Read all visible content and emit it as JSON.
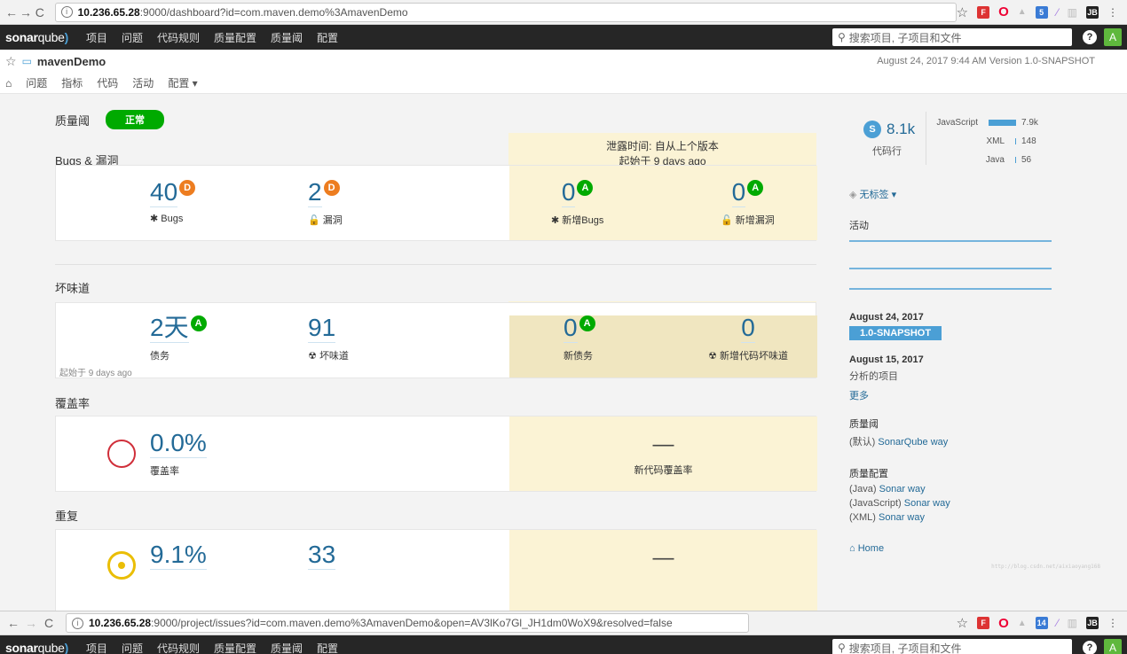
{
  "browser1": {
    "url_host": "10.236.65.28",
    "url_rest": ":9000/dashboard?id=com.maven.demo%3AmavenDemo",
    "ext_badge": "5"
  },
  "browser2": {
    "url_host": "10.236.65.28",
    "url_rest": ":9000/project/issues?id=com.maven.demo%3AmavenDemo&open=AV3lKo7Gl_JH1dm0WoX9&resolved=false",
    "ext_badge": "14"
  },
  "nav": {
    "logo_a": "sonar",
    "logo_b": "qube",
    "menu": [
      "项目",
      "问题",
      "代码规则",
      "质量配置",
      "质量阈",
      "配置"
    ],
    "search_placeholder": "搜索项目, 子项目和文件",
    "help": "?",
    "avatar": "A"
  },
  "project": {
    "name": "mavenDemo",
    "meta": "August 24, 2017 9:44 AM  Version 1.0-SNAPSHOT",
    "tabs": [
      "问题",
      "指标",
      "代码",
      "活动",
      "配置 ▾"
    ]
  },
  "quality_gate": {
    "label": "质量阈",
    "status": "正常"
  },
  "bugs": {
    "title": "Bugs & 漏洞",
    "leak_title": "泄露时间: 自从上个版本",
    "leak_sub": "起始于 9 days ago",
    "bugs_value": "40",
    "bugs_rating": "D",
    "bugs_label": "Bugs",
    "vuln_value": "2",
    "vuln_rating": "D",
    "vuln_label": "漏洞",
    "new_bugs_value": "0",
    "new_bugs_rating": "A",
    "new_bugs_label": "新增Bugs",
    "new_vuln_value": "0",
    "new_vuln_rating": "A",
    "new_vuln_label": "新增漏洞"
  },
  "smells": {
    "title": "坏味道",
    "debt_value": "2天",
    "debt_rating": "A",
    "debt_label": "债务",
    "smells_value": "91",
    "smells_label": "坏味道",
    "since": "起始于 9 days ago",
    "new_debt_value": "0",
    "new_debt_rating": "A",
    "new_debt_label": "新债务",
    "new_smells_value": "0",
    "new_smells_label": "新增代码坏味道"
  },
  "coverage": {
    "title": "覆盖率",
    "value": "0.0%",
    "label": "覆盖率",
    "new_value": "—",
    "new_label": "新代码覆盖率"
  },
  "duplications": {
    "title": "重复",
    "value": "9.1%",
    "blocks": "33",
    "new_value": "—"
  },
  "sidebar": {
    "size_badge": "S",
    "loc": "8.1k",
    "loc_label": "代码行",
    "languages": [
      {
        "name": "JavaScript",
        "value": "7.9k",
        "share": 0.975
      },
      {
        "name": "XML",
        "value": "148",
        "share": 0.018
      },
      {
        "name": "Java",
        "value": "56",
        "share": 0.007
      }
    ],
    "tags": "无标签 ▾",
    "activity_title": "活动",
    "events": [
      {
        "date": "August 24, 2017",
        "version": "1.0-SNAPSHOT"
      },
      {
        "date": "August 15, 2017",
        "text": "分析的项目"
      }
    ],
    "more": "更多",
    "qg_title": "质量阈",
    "qg_default": "(默认)",
    "qg_link": "SonarQube way",
    "qp_title": "质量配置",
    "profiles": [
      {
        "lang": "(Java)",
        "name": "Sonar way"
      },
      {
        "lang": "(JavaScript)",
        "name": "Sonar way"
      },
      {
        "lang": "(XML)",
        "name": "Sonar way"
      }
    ],
    "home": "Home",
    "watermark": "http://blog.csdn.net/aixiaoyang168"
  }
}
